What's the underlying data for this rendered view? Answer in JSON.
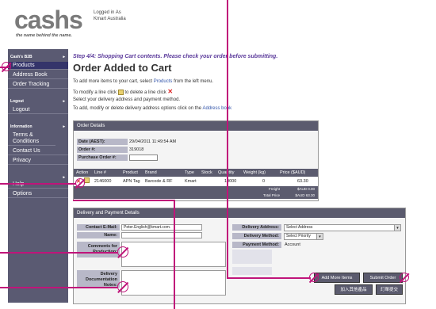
{
  "logo": {
    "word": "cashs",
    "tagline": "the name behind the name."
  },
  "login": {
    "line1": "Logged in As",
    "line2": "Kmart Australia"
  },
  "sidebar": {
    "section1": "Cash's B2B",
    "items1": [
      "Products",
      "Address Book",
      "Order Tracking"
    ],
    "section2": "Logout",
    "items2": [
      "Logout"
    ],
    "section3": "Information",
    "items3": [
      "Terms & Conditions",
      "Contact Us",
      "Privacy"
    ],
    "items4": [
      "Help",
      "Options"
    ]
  },
  "main": {
    "step": "Step 4/4: Shopping Cart contents. Please check your order before submitting.",
    "title": "Order Added to Cart",
    "instr1_pre": "To add more items to your cart, select ",
    "instr1_link": "Products",
    "instr1_post": " from the left menu.",
    "instr2_pre": "To modify a line click ",
    "instr2_mid": " to delete a line click ",
    "instr3": "Select your delivery address and payment method.",
    "instr4_pre": "To add, modify or delete delivery address options click on the ",
    "instr4_link": "Address book"
  },
  "order": {
    "panel_title": "Order Details",
    "date_label": "Date (AEST):",
    "date_value": "29/04/2011 11:49:54 AM",
    "order_label": "Order #:",
    "order_value": "319018",
    "po_label": "Purchase Order #:",
    "columns": [
      "Action",
      "Line #",
      "Product",
      "Brand",
      "Type",
      "Stock",
      "Quantity",
      "Weight (kg)",
      "Price ($AUD)"
    ],
    "row": {
      "line": "2146000",
      "product": "APN Tag",
      "brand": "Barcode & RF",
      "type": "Kmart",
      "stock": "",
      "qty": "10000",
      "weight": "0",
      "price": "63.30"
    },
    "freight_label": "Freight",
    "freight_value": "$AUD 0.00",
    "total_label": "Total Price",
    "total_value": "$AUD 63.30"
  },
  "delivery": {
    "panel_title": "Delivery and Payment Details",
    "email_label": "Contact E-Mail:",
    "email_value": "Peter.English@kmart.com.",
    "name_label": "Name:",
    "comments_label": "Comments for Production:",
    "doc_label": "Delivery Documentation Notes:",
    "addr_label": "Delivery Address:",
    "addr_value": "Select Address",
    "method_label": "Delivery Method:",
    "method_value": "Select Priority",
    "payment_label": "Payment Method:",
    "payment_value": "Account"
  },
  "buttons": {
    "add_more": "Add More Items",
    "submit": "Submit Order",
    "add_more_cn": "加入其他產品",
    "submit_cn": "訂單提交"
  },
  "colors": {
    "accent": "#5b3a9b",
    "sidebar": "#5a5a72",
    "annotation": "#c0147a"
  }
}
